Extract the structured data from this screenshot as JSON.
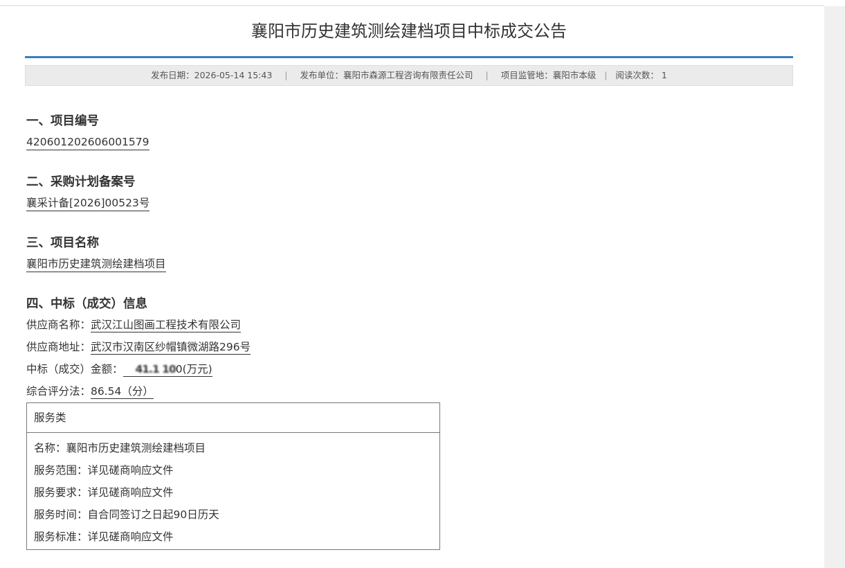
{
  "title": "襄阳市历史建筑测绘建档项目中标成交公告",
  "meta": {
    "publish_date": "发布日期：2026-05-14 15:43",
    "publisher": "发布单位：襄阳市森源工程咨询有限责任公司",
    "supervision": "项目监管地：襄阳市本级",
    "views": "阅读次数： 1",
    "separator": "|"
  },
  "sections": [
    {
      "heading": "一、项目编号",
      "value": "420601202606001579"
    },
    {
      "heading": "二、采购计划备案号",
      "value": "襄采计备[2026]00523号"
    },
    {
      "heading": "三、项目名称",
      "value": "襄阳市历史建筑测绘建档项目"
    },
    {
      "heading": "四、中标（成交）信息"
    }
  ],
  "bid_info": {
    "supplier_name_label": "供应商名称：",
    "supplier_name": "武汉江山图画工程技术有限公司",
    "supplier_address_label": "供应商地址：",
    "supplier_address": "武汉市汉南区纱帽镇微湖路296号",
    "amount_label": "中标（成交）金额：",
    "amount_obscured": "41.1 10",
    "amount_suffix": "0(万元)",
    "score_label": "综合评分法：",
    "score": "86.54（分）"
  },
  "service": {
    "category": "服务类",
    "rows": [
      "名称：襄阳市历史建筑测绘建档项目",
      "服务范围：详见磋商响应文件",
      "服务要求：详见磋商响应文件",
      "服务时间：自合同签订之日起90日历天",
      "服务标准：详见磋商响应文件"
    ]
  }
}
